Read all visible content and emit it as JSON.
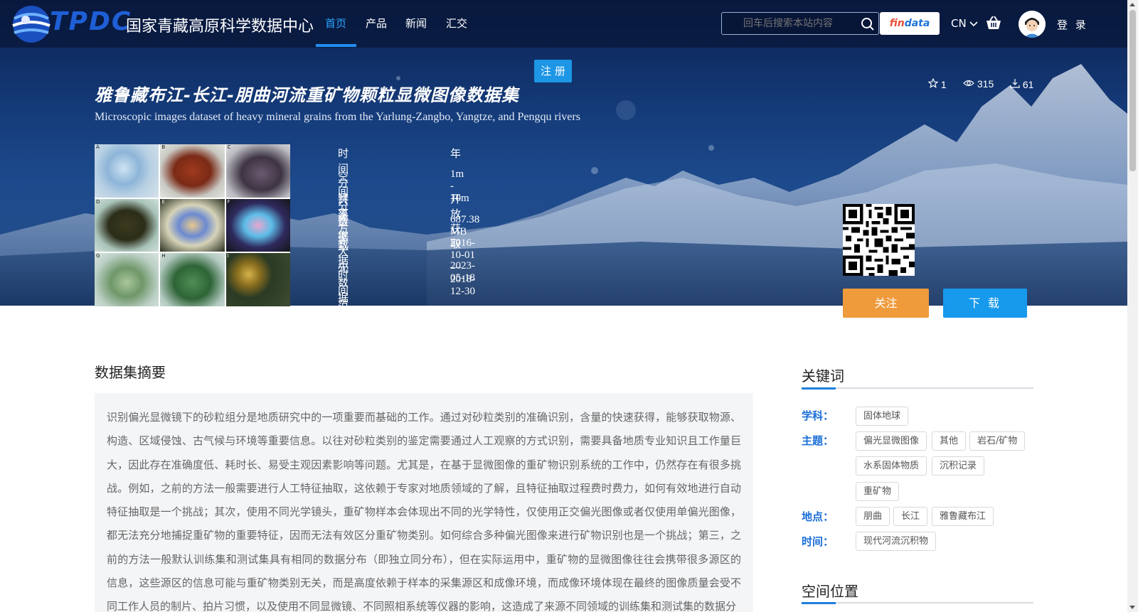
{
  "brand": {
    "logo_text": "TPDC",
    "name": "国家青藏高原科学数据中心"
  },
  "nav": {
    "items": [
      {
        "label": "首页"
      },
      {
        "label": "产品"
      },
      {
        "label": "新闻"
      },
      {
        "label": "汇交"
      }
    ],
    "active": "首页"
  },
  "search": {
    "placeholder": "回车后搜索本站内容"
  },
  "findata": {
    "part1": "fin",
    "part2": "data"
  },
  "lang": "CN",
  "login": "登 录",
  "register": "注 册",
  "dataset": {
    "title_cn": "雅鲁藏布江-长江-朋曲河流重矿物颗粒显微图像数据集",
    "title_en": "Microscopic images dataset of heavy mineral grains from the Yarlung-Zangbo, Yangtze, and Pengqu rivers",
    "stats": {
      "stars": "1",
      "views": "315",
      "downloads": "61"
    },
    "meta": [
      {
        "label": "时间分辨率",
        "value": "年"
      },
      {
        "label": "空间分辨率",
        "value": "1m - 10m"
      },
      {
        "label": "共享方式",
        "value": "开放获取"
      },
      {
        "label": "数据大小",
        "value": "687.38 MB"
      },
      {
        "label": "数据时间范围",
        "value": "2016-10-01 — 2018-12-30"
      },
      {
        "label": "元数据更新时间",
        "value": "2023-05-18"
      }
    ],
    "thumb_letters": [
      "A",
      "B",
      "C",
      "D",
      "E",
      "F",
      "G",
      "H",
      "I"
    ]
  },
  "actions": {
    "follow": "关注",
    "download": "下 载"
  },
  "abstract": {
    "heading": "数据集摘要",
    "text": "识别偏光显微镜下的砂粒组分是地质研究中的一项重要而基础的工作。通过对砂粒类别的准确识别，含量的快速获得，能够获取物源、构造、区域侵蚀、古气候与环境等重要信息。以往对砂粒类别的鉴定需要通过人工观察的方式识别，需要具备地质专业知识且工作量巨大，因此存在准确度低、耗时长、易受主观因素影响等问题。尤其是，在基于显微图像的重矿物识别系统的工作中，仍然存在有很多挑战。例如，之前的方法一般需要进行人工特征抽取，这依赖于专家对地质领域的了解，且特征抽取过程费时费力，如何有效地进行自动特征抽取是一个挑战；其次，使用不同光学镜头，重矿物样本会体现出不同的光学特性，仅使用正交偏光图像或者仅使用单偏光图像，都无法充分地捕捉重矿物的重要特征，因而无法有效区分重矿物类别。如何综合多种偏光图像来进行矿物识别也是一个挑战；第三，之前的方法一般默认训练集和测试集具有相同的数据分布（即独立同分布），但在实际运用中，重矿物的显微图像往往会携带很多源区的信息，这些源区的信息可能与重矿物类别无关，而是高度依赖于样本的采集源区和成像环境，而成像环境体现在最终的图像质量会受不同工作人员的制片、拍片习惯，以及使用不同显微镜、不同照相系统等仪器的影响，这造成了来源不同领域的训练集和测试集的数据分"
  },
  "keywords": {
    "heading": "关键词",
    "groups": [
      {
        "label": "学科：",
        "tags": [
          "固体地球"
        ]
      },
      {
        "label": "主题：",
        "tags": [
          "偏光显微图像",
          "其他",
          "岩石/矿物",
          "水系固体物质",
          "沉积记录",
          "重矿物"
        ]
      },
      {
        "label": "地点：",
        "tags": [
          "朋曲",
          "长江",
          "雅鲁藏布江"
        ]
      },
      {
        "label": "时间：",
        "tags": [
          "现代河流沉积物"
        ]
      }
    ]
  },
  "location": {
    "heading": "空间位置"
  },
  "colors": {
    "accent": "#1f8ef0",
    "follow": "#ef9b3c",
    "download": "#1799ec",
    "keyword_label": "#1a6ed8"
  }
}
